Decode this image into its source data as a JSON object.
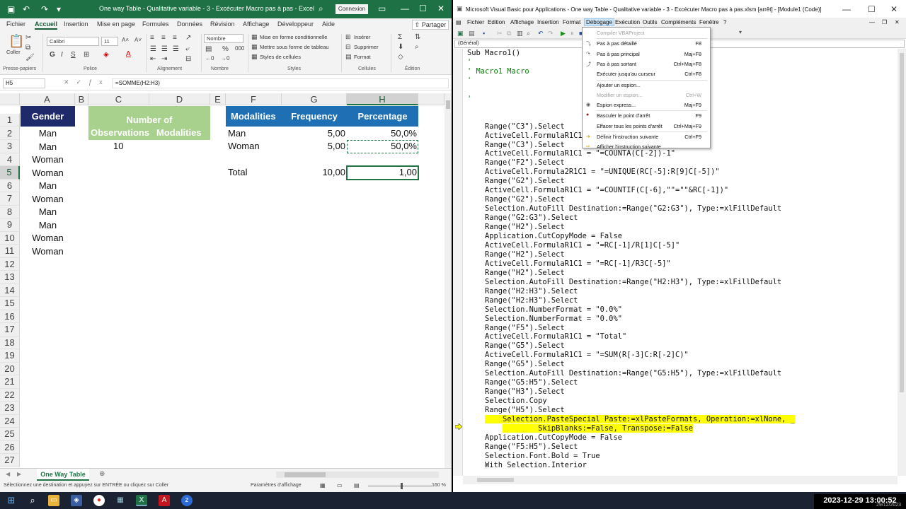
{
  "excel": {
    "title": "One way Table - Qualitative variable - 3 - Excécuter Macro pas à pas  -  Excel",
    "connexion": "Connexion",
    "share": "Partager",
    "menu": [
      "Fichier",
      "Accueil",
      "Insertion",
      "Mise en page",
      "Formules",
      "Données",
      "Révision",
      "Affichage",
      "Développeur",
      "Aide"
    ],
    "ribbon": {
      "paste": "Coller",
      "font_name": "Calibri",
      "font_size": "11",
      "number_format": "Nombre",
      "cond_format": "Mise en forme conditionnelle",
      "table_format": "Mettre sous forme de tableau",
      "cell_styles": "Styles de cellules",
      "insert": "Insérer",
      "delete": "Supprimer",
      "format": "Format",
      "groups": [
        "Presse-papiers",
        "Police",
        "Alignement",
        "Nombre",
        "Styles",
        "Cellules",
        "Édition"
      ]
    },
    "name_box": "H5",
    "formula": "=SOMME(H2:H3)",
    "columns": [
      "A",
      "B",
      "C",
      "D",
      "E",
      "F",
      "G",
      "H"
    ],
    "rows": [
      "1",
      "2",
      "3",
      "4",
      "5",
      "6",
      "7",
      "8",
      "9",
      "10",
      "11",
      "12",
      "13",
      "14",
      "15",
      "16",
      "17",
      "18",
      "19",
      "20",
      "21",
      "22",
      "23",
      "24",
      "25",
      "26",
      "27"
    ],
    "gender_header": "Gender",
    "genders": [
      "Man",
      "Man",
      "Woman",
      "Woman",
      "Man",
      "Woman",
      "Man",
      "Man",
      "Woman",
      "Woman"
    ],
    "obs_header_line1": "Number of",
    "obs_header_line2a": "Observations",
    "obs_header_line2b": "Modalities",
    "obs_count": "10",
    "table_headers": [
      "Modalities",
      "Frequency",
      "Percentage"
    ],
    "table_rows": [
      {
        "modality": "Man",
        "frequency": "5,00",
        "percentage": "50,0%"
      },
      {
        "modality": "Woman",
        "frequency": "5,00",
        "percentage": "50,0%"
      }
    ],
    "total_label": "Total",
    "total_frequency": "10,00",
    "total_percentage": "1,00",
    "sheet_tab": "One Way Table",
    "status_text": "Sélectionnez une destination et appuyez sur ENTRÉE ou cliquez sur Coller",
    "display_settings": "Paramètres d'affichage",
    "zoom": "160 %"
  },
  "vba": {
    "title": "Microsoft Visual Basic pour Applications - One way Table - Qualitative variable - 3 - Excécuter Macro pas à pas.xlsm [arrêt] - [Module1 (Code)]",
    "menu": [
      "Fichier",
      "Edition",
      "Affichage",
      "Insertion",
      "Format",
      "Débogage",
      "Exécution",
      "Outils",
      "Compléments",
      "Fenêtre",
      "?"
    ],
    "combo": "(Général)",
    "code": [
      "Sub Macro1()",
      "'",
      "' Macro1 Macro",
      "'",
      "",
      "'",
      "",
      "",
      "    Range(\"C3\").Select",
      "    ActiveCell.FormulaR1C1 = \"=COUNTA(C[-2])-1\"",
      "    Range(\"C3\").Select",
      "    ActiveCell.FormulaR1C1 = \"=COUNTA(C[-2])-1\"",
      "    Range(\"F2\").Select",
      "    ActiveCell.Formula2R1C1 = \"=UNIQUE(RC[-5]:R[9]C[-5])\"",
      "    Range(\"G2\").Select",
      "    ActiveCell.FormulaR1C1 = \"=COUNTIF(C[-6],\"\"=\"\"&RC[-1])\"",
      "    Range(\"G2\").Select",
      "    Selection.AutoFill Destination:=Range(\"G2:G3\"), Type:=xlFillDefault",
      "    Range(\"G2:G3\").Select",
      "    Range(\"H2\").Select",
      "    Application.CutCopyMode = False",
      "    ActiveCell.FormulaR1C1 = \"=RC[-1]/R[1]C[-5]\"",
      "    Range(\"H2\").Select",
      "    ActiveCell.FormulaR1C1 = \"=RC[-1]/R3C[-5]\"",
      "    Range(\"H2\").Select",
      "    Selection.AutoFill Destination:=Range(\"H2:H3\"), Type:=xlFillDefault",
      "    Range(\"H2:H3\").Select",
      "    Range(\"H2:H3\").Select",
      "    Selection.NumberFormat = \"0.0%\"",
      "    Selection.NumberFormat = \"0.0%\"",
      "    Range(\"F5\").Select",
      "    ActiveCell.FormulaR1C1 = \"Total\"",
      "    Range(\"G5\").Select",
      "    ActiveCell.FormulaR1C1 = \"=SUM(R[-3]C:R[-2]C)\"",
      "    Range(\"G5\").Select",
      "    Selection.AutoFill Destination:=Range(\"G5:H5\"), Type:=xlFillDefault",
      "    Range(\"G5:H5\").Select",
      "    Range(\"H3\").Select",
      "    Selection.Copy",
      "    Range(\"H5\").Select",
      "    Selection.PasteSpecial Paste:=xlPasteFormats, Operation:=xlNone, _",
      "        SkipBlanks:=False, Transpose:=False",
      "    Application.CutCopyMode = False",
      "    Range(\"F5:H5\").Select",
      "    Selection.Font.Bold = True",
      "    With Selection.Interior"
    ],
    "debug_menu": [
      {
        "label": "Compiler VBAProject",
        "shortcut": "",
        "disabled": true
      },
      {
        "label": "Pas à pas détaillé",
        "shortcut": "F8",
        "disabled": false,
        "icon": "step-into"
      },
      {
        "label": "Pas à pas principal",
        "shortcut": "Maj+F8",
        "disabled": false,
        "icon": "step-over"
      },
      {
        "label": "Pas à pas sortant",
        "shortcut": "Ctrl+Maj+F8",
        "disabled": false,
        "icon": "step-out"
      },
      {
        "label": "Exécuter jusqu'au curseur",
        "shortcut": "Ctrl+F8",
        "disabled": false
      },
      {
        "label": "Ajouter un espion...",
        "shortcut": "",
        "disabled": false
      },
      {
        "label": "Modifier un espion...",
        "shortcut": "Ctrl+W",
        "disabled": true
      },
      {
        "label": "Espion express...",
        "shortcut": "Maj+F9",
        "disabled": false,
        "icon": "quick-watch"
      },
      {
        "label": "Basculer le point d'arrêt",
        "shortcut": "F9",
        "disabled": false,
        "icon": "breakpoint"
      },
      {
        "label": "Effacer tous les points d'arrêt",
        "shortcut": "Ctrl+Maj+F9",
        "disabled": false
      },
      {
        "label": "Définir l'instruction suivante",
        "shortcut": "Ctrl+F9",
        "disabled": false,
        "icon": "set-next"
      },
      {
        "label": "Afficher l'instruction suivante",
        "shortcut": "",
        "disabled": false,
        "icon": "show-next"
      }
    ]
  },
  "taskbar": {
    "clock": "2023-12-29  13:00:52",
    "date_small": "29/12/2023"
  },
  "colors": {
    "excel_green": "#1e7145",
    "navy_header": "#1f2a6b",
    "blue_header": "#1f6fb5",
    "green_header": "#a9d18e",
    "highlight": "#ffff00",
    "comment": "#008000"
  }
}
